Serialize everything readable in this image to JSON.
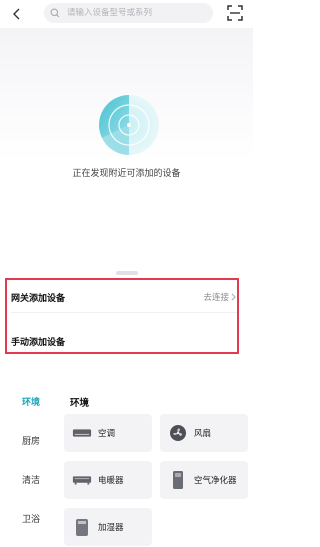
{
  "search": {
    "placeholder": "请输入设备型号或系列"
  },
  "discovery": {
    "status_text": "正在发现附近可添加的设备"
  },
  "add_options": {
    "gateway_label": "网关添加设备",
    "gateway_link": "去连接",
    "manual_label": "手动添加设备"
  },
  "categories": [
    "环境",
    "厨房",
    "清洁",
    "卫浴"
  ],
  "active_category": "环境",
  "section_title": "环境",
  "devices": [
    {
      "label": "空调",
      "icon": "air-conditioner-icon"
    },
    {
      "label": "风扇",
      "icon": "fan-icon"
    },
    {
      "label": "电暖器",
      "icon": "electric-heater-icon"
    },
    {
      "label": "空气净化器",
      "icon": "air-purifier-icon"
    },
    {
      "label": "加湿器",
      "icon": "humidifier-icon"
    }
  ],
  "colors": {
    "accent": "#1aa3b8",
    "highlight_border": "#e23a4f",
    "radar": "#5bc9d8"
  }
}
